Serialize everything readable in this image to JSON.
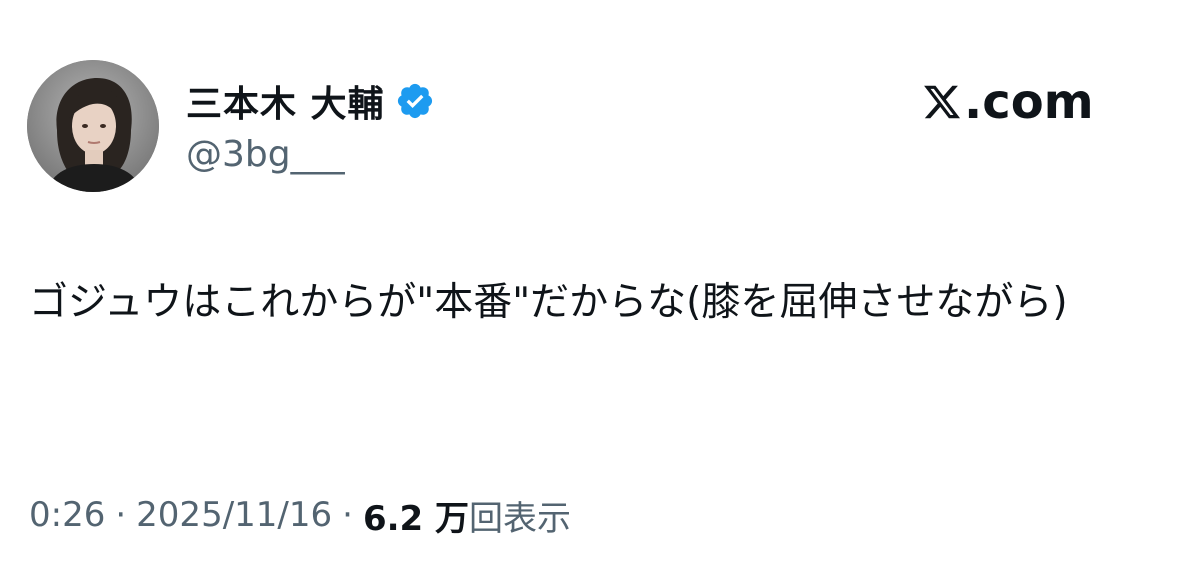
{
  "author": {
    "display_name": "三本木 大輔",
    "handle": "@3bg___",
    "verified": true,
    "verified_color": "#1d9bf0",
    "avatar_icon": "profile-photo"
  },
  "brand": {
    "text": ".com",
    "logo_icon": "x-logo-icon"
  },
  "post": {
    "text": "ゴジュウはこれからが\"本番\"だからな(膝を屈伸させながら)"
  },
  "meta": {
    "time": "0:26",
    "separator": "·",
    "date": "2025/11/16",
    "views_count": "6.2 万",
    "views_label": "回表示"
  },
  "colors": {
    "text_primary": "#0f1419",
    "text_secondary": "#536471",
    "background": "#ffffff"
  }
}
